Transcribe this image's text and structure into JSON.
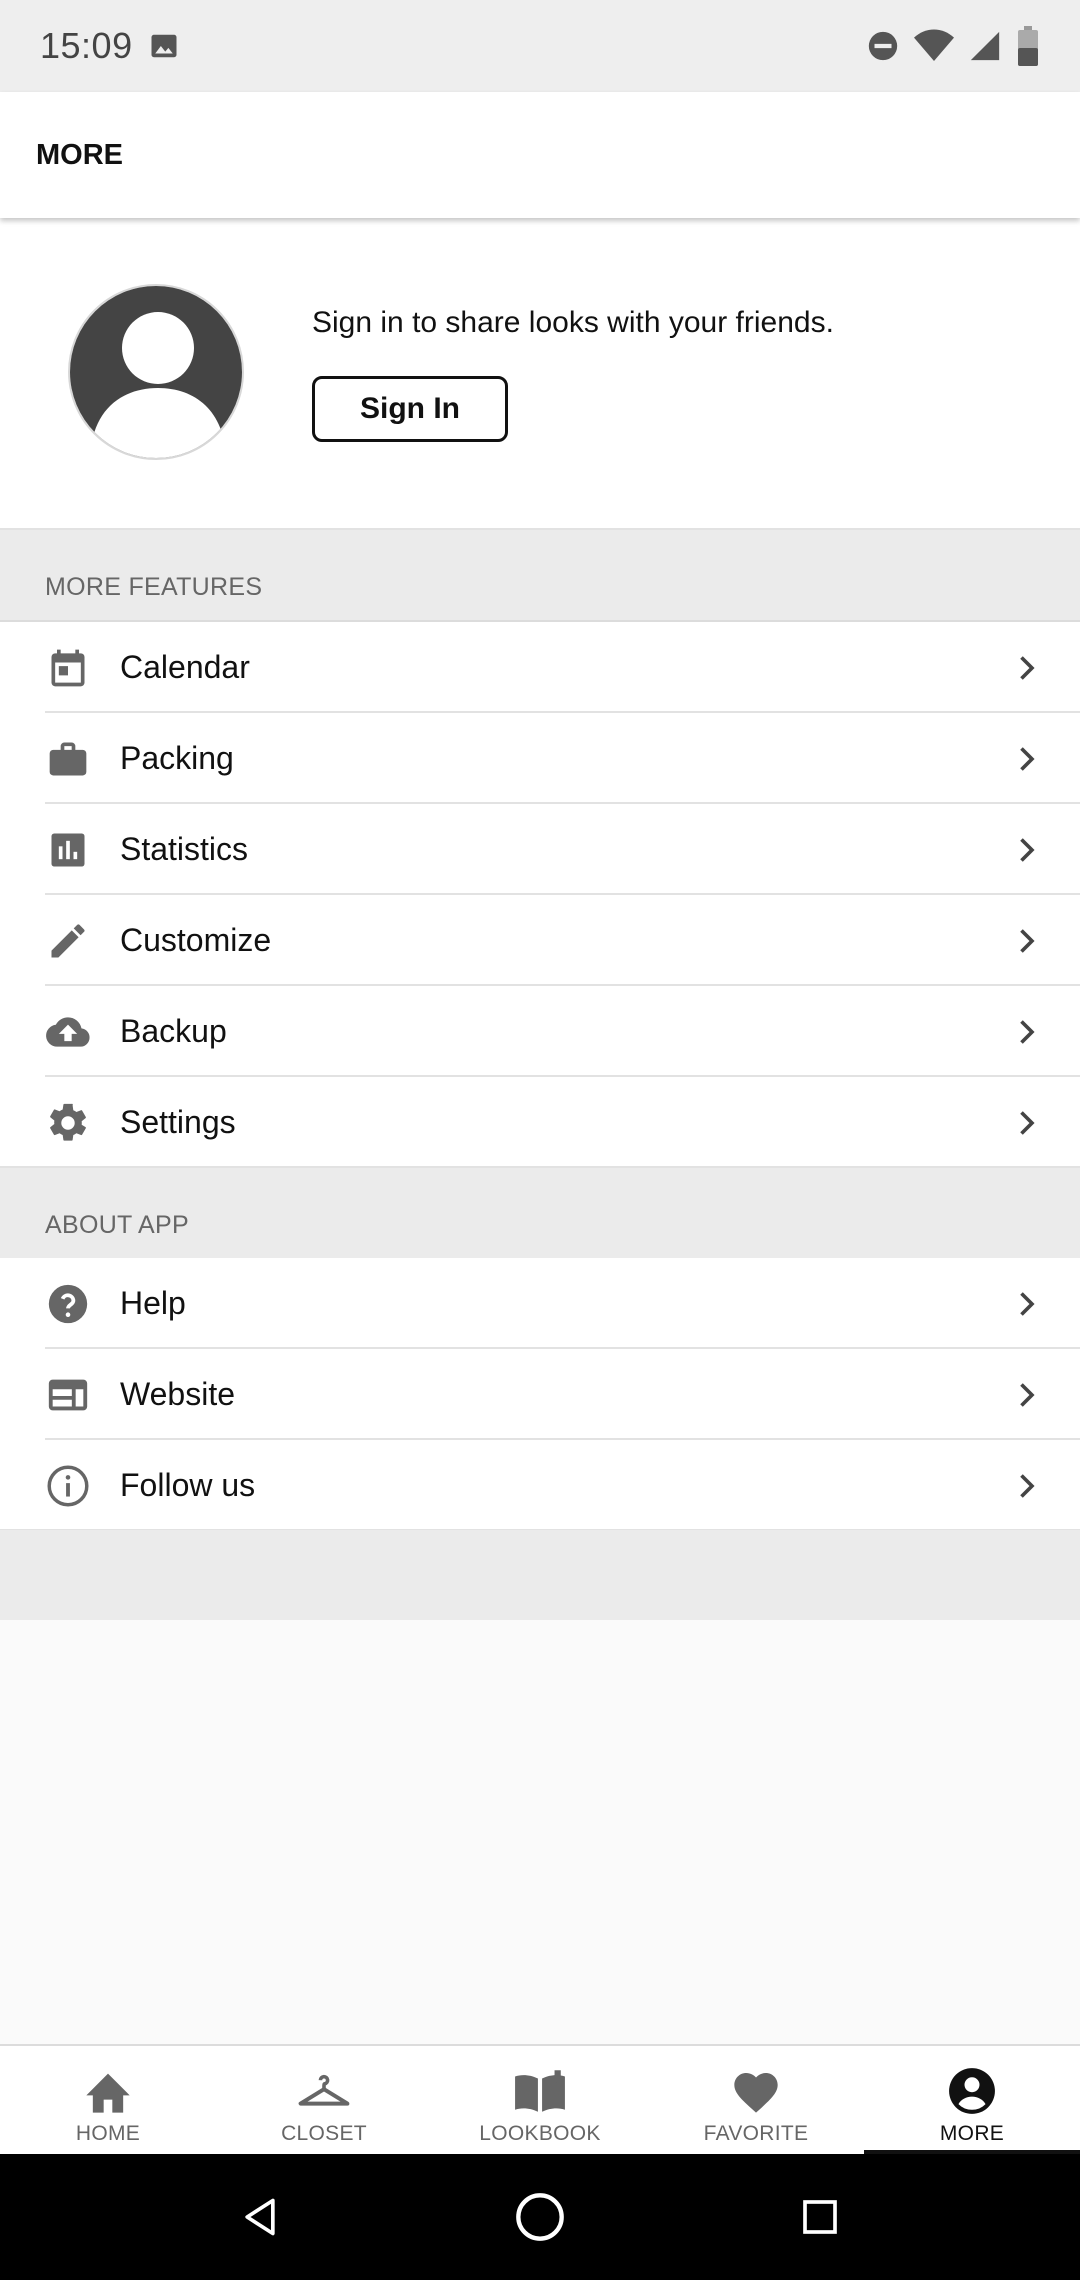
{
  "status_bar": {
    "time": "15:09"
  },
  "app_bar": {
    "title": "MORE"
  },
  "profile": {
    "prompt": "Sign in to share looks with your friends.",
    "signin_label": "Sign In"
  },
  "sections": [
    {
      "header": "MORE FEATURES",
      "items": [
        {
          "label": "Calendar",
          "icon": "calendar-icon"
        },
        {
          "label": "Packing",
          "icon": "briefcase-icon"
        },
        {
          "label": "Statistics",
          "icon": "bar-chart-icon"
        },
        {
          "label": "Customize",
          "icon": "pencil-icon"
        },
        {
          "label": "Backup",
          "icon": "cloud-upload-icon"
        },
        {
          "label": "Settings",
          "icon": "gear-icon"
        }
      ]
    },
    {
      "header": "ABOUT APP",
      "items": [
        {
          "label": "Help",
          "icon": "help-icon"
        },
        {
          "label": "Website",
          "icon": "web-icon"
        },
        {
          "label": "Follow us",
          "icon": "info-icon"
        }
      ]
    }
  ],
  "bottom_nav": [
    {
      "label": "HOME",
      "icon": "home-icon",
      "active": false
    },
    {
      "label": "CLOSET",
      "icon": "hanger-icon",
      "active": false
    },
    {
      "label": "LOOKBOOK",
      "icon": "book-icon",
      "active": false
    },
    {
      "label": "FAVORITE",
      "icon": "heart-icon",
      "active": false
    },
    {
      "label": "MORE",
      "icon": "account-icon",
      "active": true
    }
  ],
  "colors": {
    "icon_gray": "#666666",
    "section_bg": "#ebebeb",
    "active": "#111111"
  }
}
